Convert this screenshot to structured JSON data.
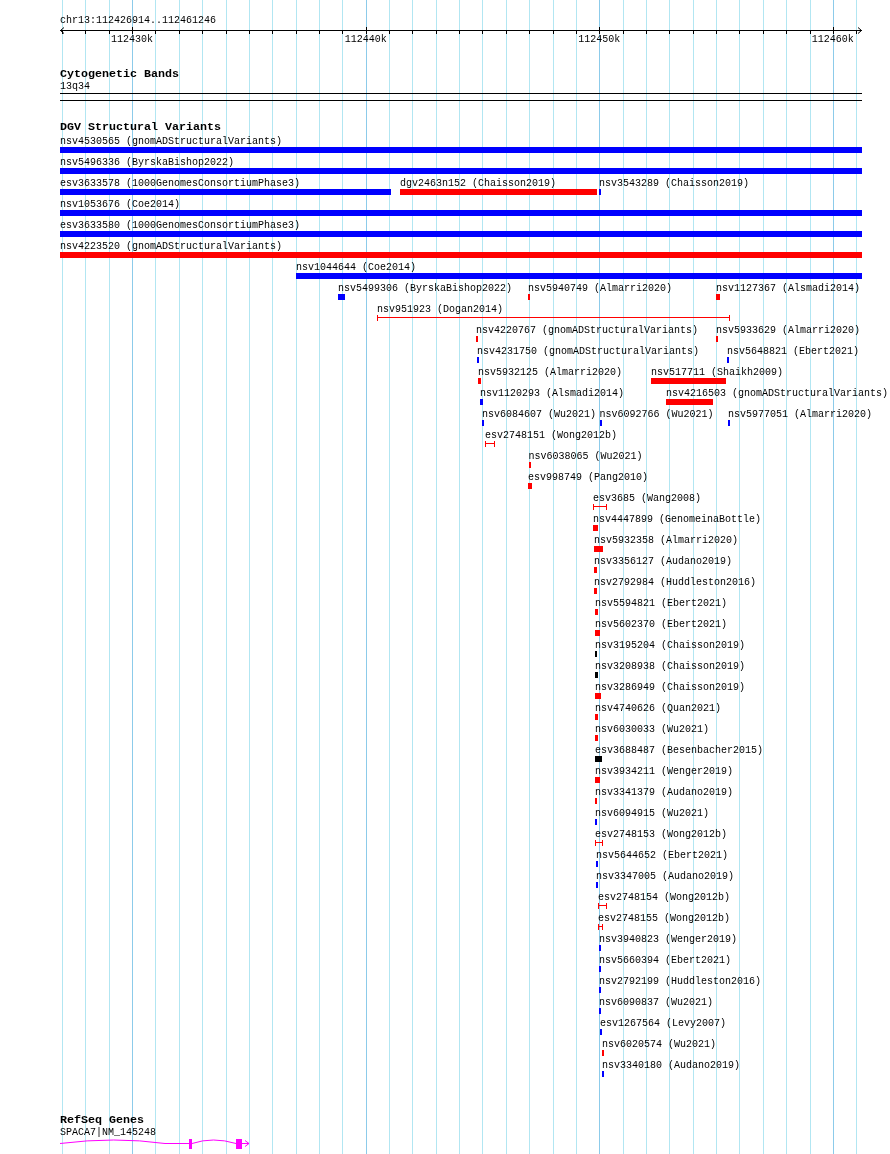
{
  "ruler": {
    "locus": "chr13:112426914..112461246",
    "ticks": [
      "112430k",
      "112440k",
      "112450k",
      "112460k"
    ]
  },
  "tracks": [
    {
      "kind": "cytoband",
      "title": "Cytogenetic Bands",
      "band": "13q34"
    },
    {
      "kind": "variants",
      "title": "DGV Structural Variants",
      "rows": [
        {
          "features": [
            {
              "label": "nsv4530565 (gnomADStructuralVariants)",
              "kind": "bar",
              "color": "#0000ff"
            }
          ]
        },
        {
          "features": [
            {
              "label": "nsv5496336 (ByrskaBishop2022)",
              "kind": "bar",
              "color": "#0000ff"
            }
          ]
        },
        {
          "features": [
            {
              "label": "esv3633578 (1000GenomesConsortiumPhase3)",
              "kind": "bar",
              "color": "#0000ff"
            },
            {
              "label": "dgv2463n152 (Chaisson2019)",
              "kind": "bar",
              "color": "#ff0000"
            },
            {
              "label": "nsv3543289 (Chaisson2019)",
              "kind": "bar",
              "color": "#0000ff"
            }
          ]
        },
        {
          "features": [
            {
              "label": "nsv1053676 (Coe2014)",
              "kind": "bar",
              "color": "#0000ff"
            }
          ]
        },
        {
          "features": [
            {
              "label": "esv3633580 (1000GenomesConsortiumPhase3)",
              "kind": "bar",
              "color": "#0000ff"
            }
          ]
        },
        {
          "features": [
            {
              "label": "nsv4223520 (gnomADStructuralVariants)",
              "kind": "bar",
              "color": "#ff0000"
            }
          ]
        },
        {
          "features": [
            {
              "label": "nsv1044644 (Coe2014)",
              "kind": "bar",
              "color": "#0000ff"
            }
          ]
        },
        {
          "features": [
            {
              "label": "nsv5499306 (ByrskaBishop2022)",
              "kind": "bar",
              "color": "#0000ff"
            },
            {
              "label": "nsv5940749 (Almarri2020)",
              "kind": "bar",
              "color": "#ff0000"
            },
            {
              "label": "nsv1127367 (Alsmadi2014)",
              "kind": "bar",
              "color": "#ff0000"
            }
          ]
        },
        {
          "features": [
            {
              "label": "nsv951923 (Dogan2014)",
              "kind": "interval",
              "color": "#ff0000"
            }
          ]
        },
        {
          "features": [
            {
              "label": "nsv4220767 (gnomADStructuralVariants)",
              "kind": "bar",
              "color": "#ff0000"
            },
            {
              "label": "nsv5933629 (Almarri2020)",
              "kind": "bar",
              "color": "#ff0000"
            }
          ]
        },
        {
          "features": [
            {
              "label": "nsv4231750 (gnomADStructuralVariants)",
              "kind": "bar",
              "color": "#0000ff"
            },
            {
              "label": "nsv5648821 (Ebert2021)",
              "kind": "bar",
              "color": "#0000ff"
            }
          ]
        },
        {
          "features": [
            {
              "label": "nsv5932125 (Almarri2020)",
              "kind": "bar",
              "color": "#ff0000"
            },
            {
              "label": "nsv517711 (Shaikh2009)",
              "kind": "bar",
              "color": "#ff0000"
            }
          ]
        },
        {
          "features": [
            {
              "label": "nsv1120293 (Alsmadi2014)",
              "kind": "bar",
              "color": "#0000ff"
            },
            {
              "label": "nsv4216503 (gnomADStructuralVariants)",
              "kind": "bar",
              "color": "#ff0000"
            }
          ]
        },
        {
          "features": [
            {
              "label": "nsv6084607 (Wu2021)",
              "kind": "bar",
              "color": "#0000ff"
            },
            {
              "label": "nsv6092766 (Wu2021)",
              "kind": "bar",
              "color": "#0000ff"
            },
            {
              "label": "nsv5977051 (Almarri2020)",
              "kind": "bar",
              "color": "#0000ff"
            }
          ]
        },
        {
          "features": [
            {
              "label": "esv2748151 (Wong2012b)",
              "kind": "interval",
              "color": "#ff0000"
            }
          ]
        },
        {
          "features": [
            {
              "label": "nsv6038065 (Wu2021)",
              "kind": "bar",
              "color": "#ff0000"
            }
          ]
        },
        {
          "features": [
            {
              "label": "esv998749 (Pang2010)",
              "kind": "bar",
              "color": "#ff0000"
            }
          ]
        },
        {
          "features": [
            {
              "label": "esv3685 (Wang2008)",
              "kind": "interval",
              "color": "#ff0000"
            }
          ]
        },
        {
          "features": [
            {
              "label": "nsv4447899 (GenomeinaBottle)",
              "kind": "bar",
              "color": "#ff0000"
            }
          ]
        },
        {
          "features": [
            {
              "label": "nsv5932358 (Almarri2020)",
              "kind": "bar",
              "color": "#ff0000"
            }
          ]
        },
        {
          "features": [
            {
              "label": "nsv3356127 (Audano2019)",
              "kind": "bar",
              "color": "#ff0000"
            }
          ]
        },
        {
          "features": [
            {
              "label": "nsv2792984 (Huddleston2016)",
              "kind": "bar",
              "color": "#ff0000"
            }
          ]
        },
        {
          "features": [
            {
              "label": "nsv5594821 (Ebert2021)",
              "kind": "bar",
              "color": "#ff0000"
            }
          ]
        },
        {
          "features": [
            {
              "label": "nsv5602370 (Ebert2021)",
              "kind": "bar",
              "color": "#ff0000"
            }
          ]
        },
        {
          "features": [
            {
              "label": "nsv3195204 (Chaisson2019)",
              "kind": "bar",
              "color": "#000000"
            }
          ]
        },
        {
          "features": [
            {
              "label": "nsv3208938 (Chaisson2019)",
              "kind": "bar",
              "color": "#000000"
            }
          ]
        },
        {
          "features": [
            {
              "label": "nsv3286949 (Chaisson2019)",
              "kind": "bar",
              "color": "#ff0000"
            }
          ]
        },
        {
          "features": [
            {
              "label": "nsv4740626 (Quan2021)",
              "kind": "bar",
              "color": "#ff0000"
            }
          ]
        },
        {
          "features": [
            {
              "label": "nsv6030033 (Wu2021)",
              "kind": "bar",
              "color": "#ff0000"
            }
          ]
        },
        {
          "features": [
            {
              "label": "esv3688487 (Besenbacher2015)",
              "kind": "bar",
              "color": "#000000"
            }
          ]
        },
        {
          "features": [
            {
              "label": "nsv3934211 (Wenger2019)",
              "kind": "bar",
              "color": "#ff0000"
            }
          ]
        },
        {
          "features": [
            {
              "label": "nsv3341379 (Audano2019)",
              "kind": "bar",
              "color": "#ff0000"
            }
          ]
        },
        {
          "features": [
            {
              "label": "nsv6094915 (Wu2021)",
              "kind": "bar",
              "color": "#0000ff"
            }
          ]
        },
        {
          "features": [
            {
              "label": "esv2748153 (Wong2012b)",
              "kind": "interval",
              "color": "#ff0000"
            }
          ]
        },
        {
          "features": [
            {
              "label": "nsv5644652 (Ebert2021)",
              "kind": "bar",
              "color": "#0000ff"
            }
          ]
        },
        {
          "features": [
            {
              "label": "nsv3347005 (Audano2019)",
              "kind": "bar",
              "color": "#0000ff"
            }
          ]
        },
        {
          "features": [
            {
              "label": "esv2748154 (Wong2012b)",
              "kind": "interval",
              "color": "#ff0000"
            }
          ]
        },
        {
          "features": [
            {
              "label": "esv2748155 (Wong2012b)",
              "kind": "interval",
              "color": "#ff0000"
            }
          ]
        },
        {
          "features": [
            {
              "label": "nsv3940823 (Wenger2019)",
              "kind": "bar",
              "color": "#0000ff"
            }
          ]
        },
        {
          "features": [
            {
              "label": "nsv5660394 (Ebert2021)",
              "kind": "bar",
              "color": "#0000ff"
            }
          ]
        },
        {
          "features": [
            {
              "label": "nsv2792199 (Huddleston2016)",
              "kind": "bar",
              "color": "#0000ff"
            }
          ]
        },
        {
          "features": [
            {
              "label": "nsv6090837 (Wu2021)",
              "kind": "bar",
              "color": "#0000ff"
            }
          ]
        },
        {
          "features": [
            {
              "label": "esv1267564 (Levy2007)",
              "kind": "bar",
              "color": "#0000ff"
            }
          ]
        },
        {
          "features": [
            {
              "label": "nsv6020574 (Wu2021)",
              "kind": "bar",
              "color": "#ff0000"
            }
          ]
        },
        {
          "features": [
            {
              "label": "nsv3340180 (Audano2019)",
              "kind": "bar",
              "color": "#0000ff"
            }
          ]
        }
      ]
    },
    {
      "kind": "genes",
      "title": "RefSeq Genes",
      "genes": [
        {
          "label": "SPACA7|NM_145248"
        }
      ]
    }
  ]
}
